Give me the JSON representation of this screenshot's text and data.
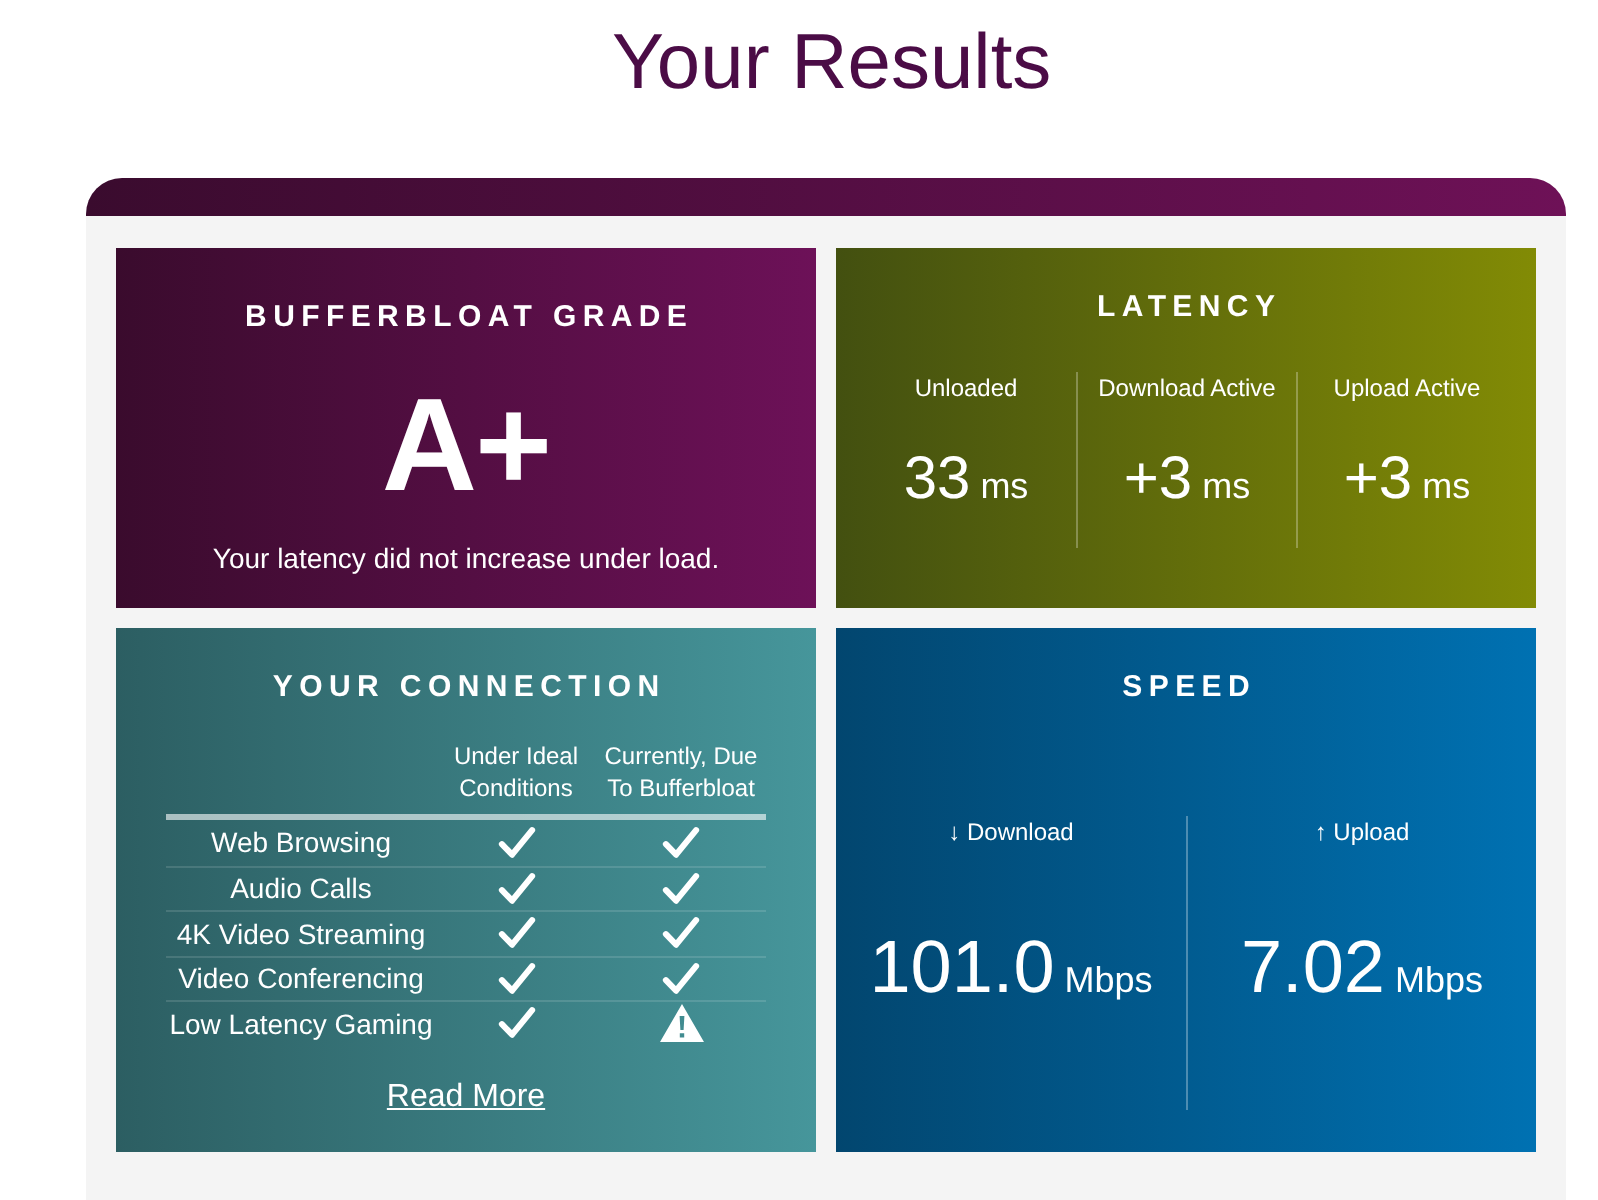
{
  "title": "Your Results",
  "grade": {
    "heading": "BUFFERBLOAT GRADE",
    "grade": "A+",
    "summary": "Your latency did not increase under load."
  },
  "latency": {
    "heading": "LATENCY",
    "metrics": [
      {
        "label": "Unloaded",
        "value": "33",
        "unit": "ms"
      },
      {
        "label": "Download Active",
        "value": "+3",
        "unit": "ms"
      },
      {
        "label": "Upload Active",
        "value": "+3",
        "unit": "ms"
      }
    ]
  },
  "connection": {
    "heading": "YOUR CONNECTION",
    "columns": [
      "Under Ideal Conditions",
      "Currently, Due To Bufferbloat"
    ],
    "rows": [
      {
        "activity": "Web Browsing",
        "ideal_ok": true,
        "current_ok": true
      },
      {
        "activity": "Audio Calls",
        "ideal_ok": true,
        "current_ok": true
      },
      {
        "activity": "4K Video Streaming",
        "ideal_ok": true,
        "current_ok": true
      },
      {
        "activity": "Video Conferencing",
        "ideal_ok": true,
        "current_ok": true
      },
      {
        "activity": "Low Latency Gaming",
        "ideal_ok": true,
        "current_ok": false
      }
    ],
    "link": "Read More"
  },
  "speed": {
    "heading": "SPEED",
    "metrics": [
      {
        "label": "↓ Download",
        "value": "101.0",
        "unit": "Mbps"
      },
      {
        "label": "↑ Upload",
        "value": "7.02",
        "unit": "Mbps"
      }
    ]
  }
}
